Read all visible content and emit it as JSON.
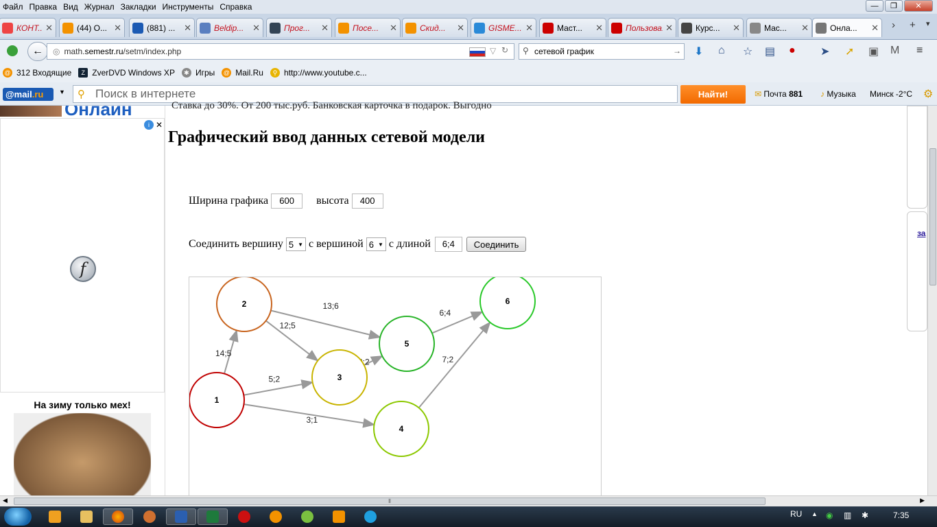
{
  "menu": [
    "Файл",
    "Правка",
    "Вид",
    "Журнал",
    "Закладки",
    "Инструменты",
    "Справка"
  ],
  "tabs": [
    {
      "label": "КОНТ...",
      "color": "#e44",
      "red": true
    },
    {
      "label": "(44) О...",
      "color": "#f39200",
      "red": false
    },
    {
      "label": "(881) ...",
      "color": "#1b5ab3",
      "red": false
    },
    {
      "label": "Beldip...",
      "color": "#5a7fc0",
      "red": true
    },
    {
      "label": "Прог...",
      "color": "#345",
      "red": true
    },
    {
      "label": "Посе...",
      "color": "#f39200",
      "red": true
    },
    {
      "label": "Скид...",
      "color": "#f39200",
      "red": true
    },
    {
      "label": "GISME...",
      "color": "#2a8ad8",
      "red": true
    },
    {
      "label": "Маст...",
      "color": "#c00",
      "red": false
    },
    {
      "label": "Пользова...",
      "color": "#c00",
      "red": true
    },
    {
      "label": "Курс...",
      "color": "#444",
      "red": false
    },
    {
      "label": "Мас...",
      "color": "#888",
      "red": false
    },
    {
      "label": "Онла...",
      "color": "#777",
      "red": false
    }
  ],
  "url": {
    "prefix": "math.",
    "domain": "semestr.ru",
    "path": "/setm/index.php"
  },
  "browser_search": "сетевой график",
  "bookmarks": [
    "312 Входящие",
    "ZverDVD Windows XP",
    "Игры",
    "Mail.Ru",
    "http://www.youtube.c..."
  ],
  "mailru": {
    "logo_a": "@mail",
    "logo_b": ".ru",
    "placeholder": "Поиск в интернете",
    "find": "Найти!",
    "mail_label": "Почта",
    "mail_count": "881",
    "music": "Музыка",
    "weather": "Минск -2°C"
  },
  "page": {
    "banner_top": "Онлайн",
    "banner_line": "Ставка до 30%. От 200 тыс.руб. Банковская карточка в подарок. Выгодно",
    "title": "Графический ввод данных сетевой модели",
    "width_label": "Ширина графика",
    "width_value": "600",
    "height_label": "высота",
    "height_value": "400",
    "connect_label": "Соединить вершину",
    "from_vertex": "5",
    "with_label": "с вершиной",
    "to_vertex": "6",
    "length_label": "с длиной",
    "length_value": "6;4",
    "connect_button": "Соединить",
    "ad_title": "На зиму только мех!"
  },
  "graph": {
    "nodes": [
      {
        "id": "1",
        "color": "#c00000"
      },
      {
        "id": "2",
        "color": "#c8641e"
      },
      {
        "id": "3",
        "color": "#c8b400"
      },
      {
        "id": "4",
        "color": "#8cc800"
      },
      {
        "id": "5",
        "color": "#28b428"
      },
      {
        "id": "6",
        "color": "#28c828"
      }
    ],
    "edges": [
      {
        "from": "1",
        "to": "2",
        "label": "14;5"
      },
      {
        "from": "1",
        "to": "3",
        "label": "5;2"
      },
      {
        "from": "1",
        "to": "4",
        "label": "3;1"
      },
      {
        "from": "2",
        "to": "3",
        "label": "12;5"
      },
      {
        "from": "2",
        "to": "5",
        "label": "13;6"
      },
      {
        "from": "3",
        "to": "5",
        "label": "3;2"
      },
      {
        "from": "5",
        "to": "6",
        "label": "6;4"
      },
      {
        "from": "4",
        "to": "6",
        "label": "7;2"
      }
    ]
  },
  "taskbar": {
    "lang": "RU",
    "time": "7:35"
  }
}
